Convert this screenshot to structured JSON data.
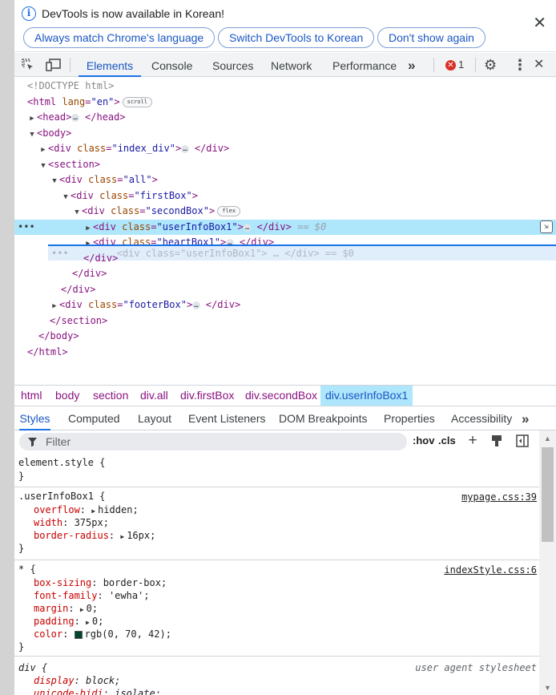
{
  "infobar": {
    "message": "DevTools is now available in Korean!",
    "buttons": [
      "Always match Chrome's language",
      "Switch DevTools to Korean",
      "Don't show again"
    ],
    "close": "✕"
  },
  "toolbar": {
    "tabs": [
      "Elements",
      "Console",
      "Sources",
      "Network",
      "Performance"
    ],
    "more": "»",
    "error_count": "1",
    "error_glyph": "✕",
    "settings": "⚙",
    "kebab": "⋮",
    "close": "✕"
  },
  "dom": {
    "doctype": "<!DOCTYPE html>",
    "html_open": "<html ",
    "html_attr": "lang",
    "html_val": "\"en\"",
    "html_close_bracket": ">",
    "scroll_badge": "scroll",
    "head": "<head>",
    "head_end": "</head>",
    "body_open": "<body>",
    "div_open": "<div ",
    "class_attr": "class",
    "index_div": "\"index_div\"",
    "gt": ">",
    "div_close": "</div>",
    "section_open": "<section>",
    "all": "\"all\"",
    "firstBox": "\"firstBox\"",
    "secondBox": "\"secondBox\"",
    "flex_badge": "flex",
    "userInfoBox1": "\"userInfoBox1\"",
    "eq0": "== $0",
    "heartBox1": "\"heartBox1\"",
    "footerBox": "\"footerBox\"",
    "section_close": "</section>",
    "body_close": "</body>",
    "html_close": "</html>",
    "ellipsis": "…",
    "left_dots": "•••",
    "ghost_text": "<div class=\"userInfoBox1\"> … </div> == $0",
    "ghost_dots": "•••"
  },
  "breadcrumbs": [
    "html",
    "body",
    "section",
    "div.all",
    "div.firstBox",
    "div.secondBox",
    "div.userInfoBox1"
  ],
  "subtabs": [
    "Styles",
    "Computed",
    "Layout",
    "Event Listeners",
    "DOM Breakpoints",
    "Properties",
    "Accessibility"
  ],
  "subtabs_more": "»",
  "filter": {
    "placeholder": "Filter",
    "hov": ":hov",
    "cls": ".cls"
  },
  "styles": {
    "element_style": "element.style {",
    "close_brace": "}",
    "rule1": {
      "selector": ".userInfoBox1 {",
      "source": "mypage.css:39",
      "props": [
        {
          "name": "overflow",
          "value": "hidden",
          "tri": true
        },
        {
          "name": "width",
          "value": "375px",
          "tri": false
        },
        {
          "name": "border-radius",
          "value": "16px",
          "tri": true
        }
      ]
    },
    "rule2": {
      "selector": "* {",
      "source": "indexStyle.css:6",
      "props": [
        {
          "name": "box-sizing",
          "value": "border-box;",
          "tri": false
        },
        {
          "name": "font-family",
          "value": "'ewha';",
          "tri": false
        },
        {
          "name": "margin",
          "value": "0;",
          "tri": true
        },
        {
          "name": "padding",
          "value": "0;",
          "tri": true
        },
        {
          "name": "color",
          "value": "rgb(0, 70, 42);",
          "tri": false
        }
      ]
    },
    "rule3": {
      "selector": "div {",
      "source": "user agent stylesheet",
      "props": [
        {
          "name": "display",
          "value": "block;"
        },
        {
          "name": "unicode-bidi",
          "value": "isolate;"
        }
      ]
    },
    "color_swatch": "#00462a"
  },
  "colors": {
    "accent": "#1a73e8",
    "selected_row": "#aee6fb",
    "error": "#d93025"
  }
}
